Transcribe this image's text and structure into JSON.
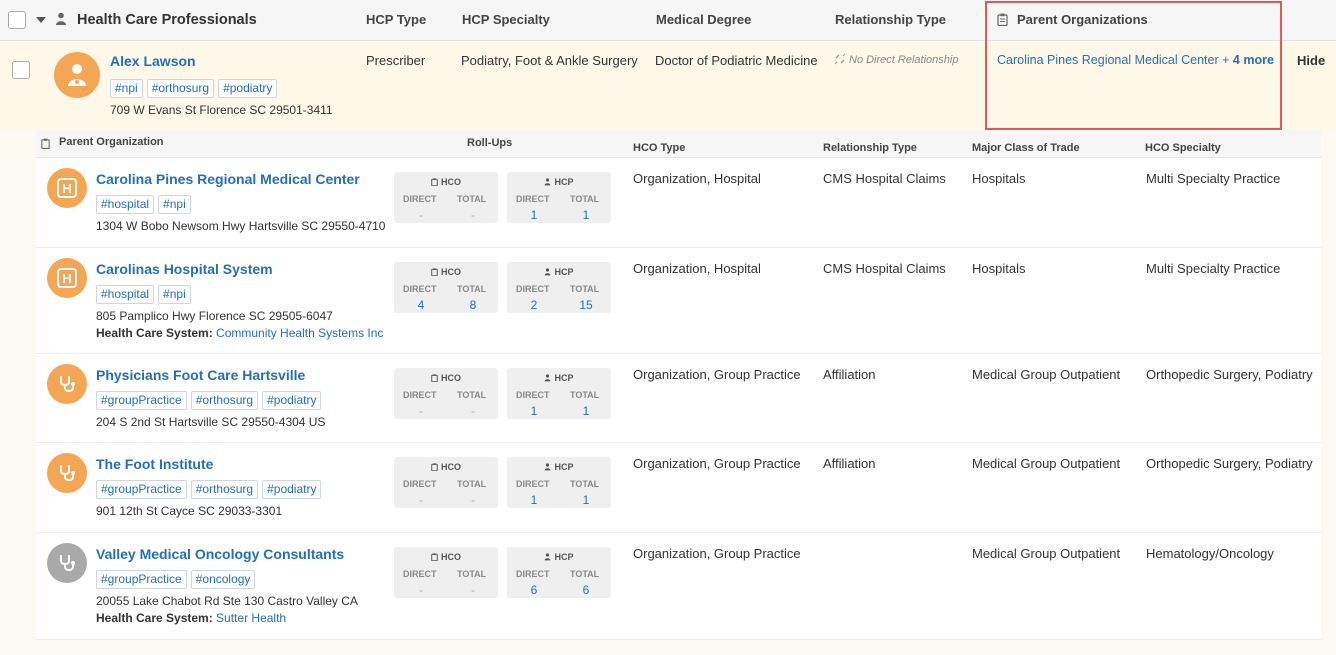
{
  "header": {
    "title": "Health Care Professionals",
    "hcp_type": "HCP Type",
    "hcp_specialty": "HCP Specialty",
    "medical_degree": "Medical Degree",
    "relationship_type": "Relationship Type",
    "parent_orgs": "Parent Organizations"
  },
  "hcp": {
    "name": "Alex Lawson",
    "tags": [
      "#npi",
      "#orthosurg",
      "#podiatry"
    ],
    "address": "709 W Evans St Florence SC 29501-3411",
    "type": "Prescriber",
    "specialty": "Podiatry, Foot & Ankle Surgery",
    "degree": "Doctor of Podiatric Medicine",
    "relationship": "No Direct Relationship",
    "parent_org_link": "Carolina Pines Regional Medical Center +",
    "more_link": "4 more",
    "hide_link": "Hide"
  },
  "subtable": {
    "columns": {
      "parent_org": "Parent Organization",
      "rollups": "Roll-Ups",
      "hco_type": "HCO Type",
      "relationship_type": "Relationship Type",
      "major_class": "Major Class of Trade",
      "hco_specialty": "HCO Specialty"
    },
    "rollup_labels": {
      "hco": "HCO",
      "hcp": "HCP",
      "direct": "DIRECT",
      "total": "TOTAL"
    },
    "hcs_label": "Health Care System:",
    "rows": [
      {
        "icon": "hospital-icon",
        "name": "Carolina Pines Regional Medical Center",
        "tags": [
          "#hospital",
          "#npi"
        ],
        "address": "1304 W Bobo Newsom Hwy Hartsville SC 29550-4710",
        "hcs": "",
        "hco_direct": "-",
        "hco_total": "-",
        "hcp_direct": "1",
        "hcp_total": "1",
        "hco_type": "Organization, Hospital",
        "relationship": "CMS Hospital Claims",
        "major_class": "Hospitals",
        "specialty": "Multi Specialty Practice"
      },
      {
        "icon": "hospital-icon",
        "name": "Carolinas Hospital System",
        "tags": [
          "#hospital",
          "#npi"
        ],
        "address": "805 Pamplico Hwy Florence SC 29505-6047",
        "hcs": "Community Health Systems Inc",
        "hco_direct": "4",
        "hco_total": "8",
        "hcp_direct": "2",
        "hcp_total": "15",
        "hco_type": "Organization, Hospital",
        "relationship": "CMS Hospital Claims",
        "major_class": "Hospitals",
        "specialty": "Multi Specialty Practice"
      },
      {
        "icon": "stethoscope-icon",
        "name": "Physicians Foot Care Hartsville",
        "tags": [
          "#groupPractice",
          "#orthosurg",
          "#podiatry"
        ],
        "address": "204 S 2nd St Hartsville SC 29550-4304 US",
        "hcs": "",
        "hco_direct": "-",
        "hco_total": "-",
        "hcp_direct": "1",
        "hcp_total": "1",
        "hco_type": "Organization, Group Practice",
        "relationship": "Affiliation",
        "major_class": "Medical Group Outpatient",
        "specialty": "Orthopedic Surgery, Podiatry"
      },
      {
        "icon": "stethoscope-icon",
        "name": "The Foot Institute",
        "tags": [
          "#groupPractice",
          "#orthosurg",
          "#podiatry"
        ],
        "address": "901 12th St Cayce SC 29033-3301",
        "hcs": "",
        "hco_direct": "-",
        "hco_total": "-",
        "hcp_direct": "1",
        "hcp_total": "1",
        "hco_type": "Organization, Group Practice",
        "relationship": "Affiliation",
        "major_class": "Medical Group Outpatient",
        "specialty": "Orthopedic Surgery, Podiatry"
      },
      {
        "icon": "stethoscope-icon",
        "name": "Valley Medical Oncology Consultants",
        "tags": [
          "#groupPractice",
          "#oncology"
        ],
        "address": "20055 Lake Chabot Rd Ste 130 Castro Valley CA",
        "hcs": "Sutter Health",
        "hco_direct": "-",
        "hco_total": "-",
        "hcp_direct": "6",
        "hcp_total": "6",
        "hco_type": "Organization, Group Practice",
        "relationship": "",
        "major_class": "Medical Group Outpatient",
        "specialty": "Hematology/Oncology"
      }
    ]
  },
  "colors": {
    "accent": "#2470b8",
    "avatar_orange": "#f5a655",
    "avatar_gray": "#a9a9a9",
    "highlight": "#e05a5a",
    "row_bg": "#fdf8e8"
  }
}
